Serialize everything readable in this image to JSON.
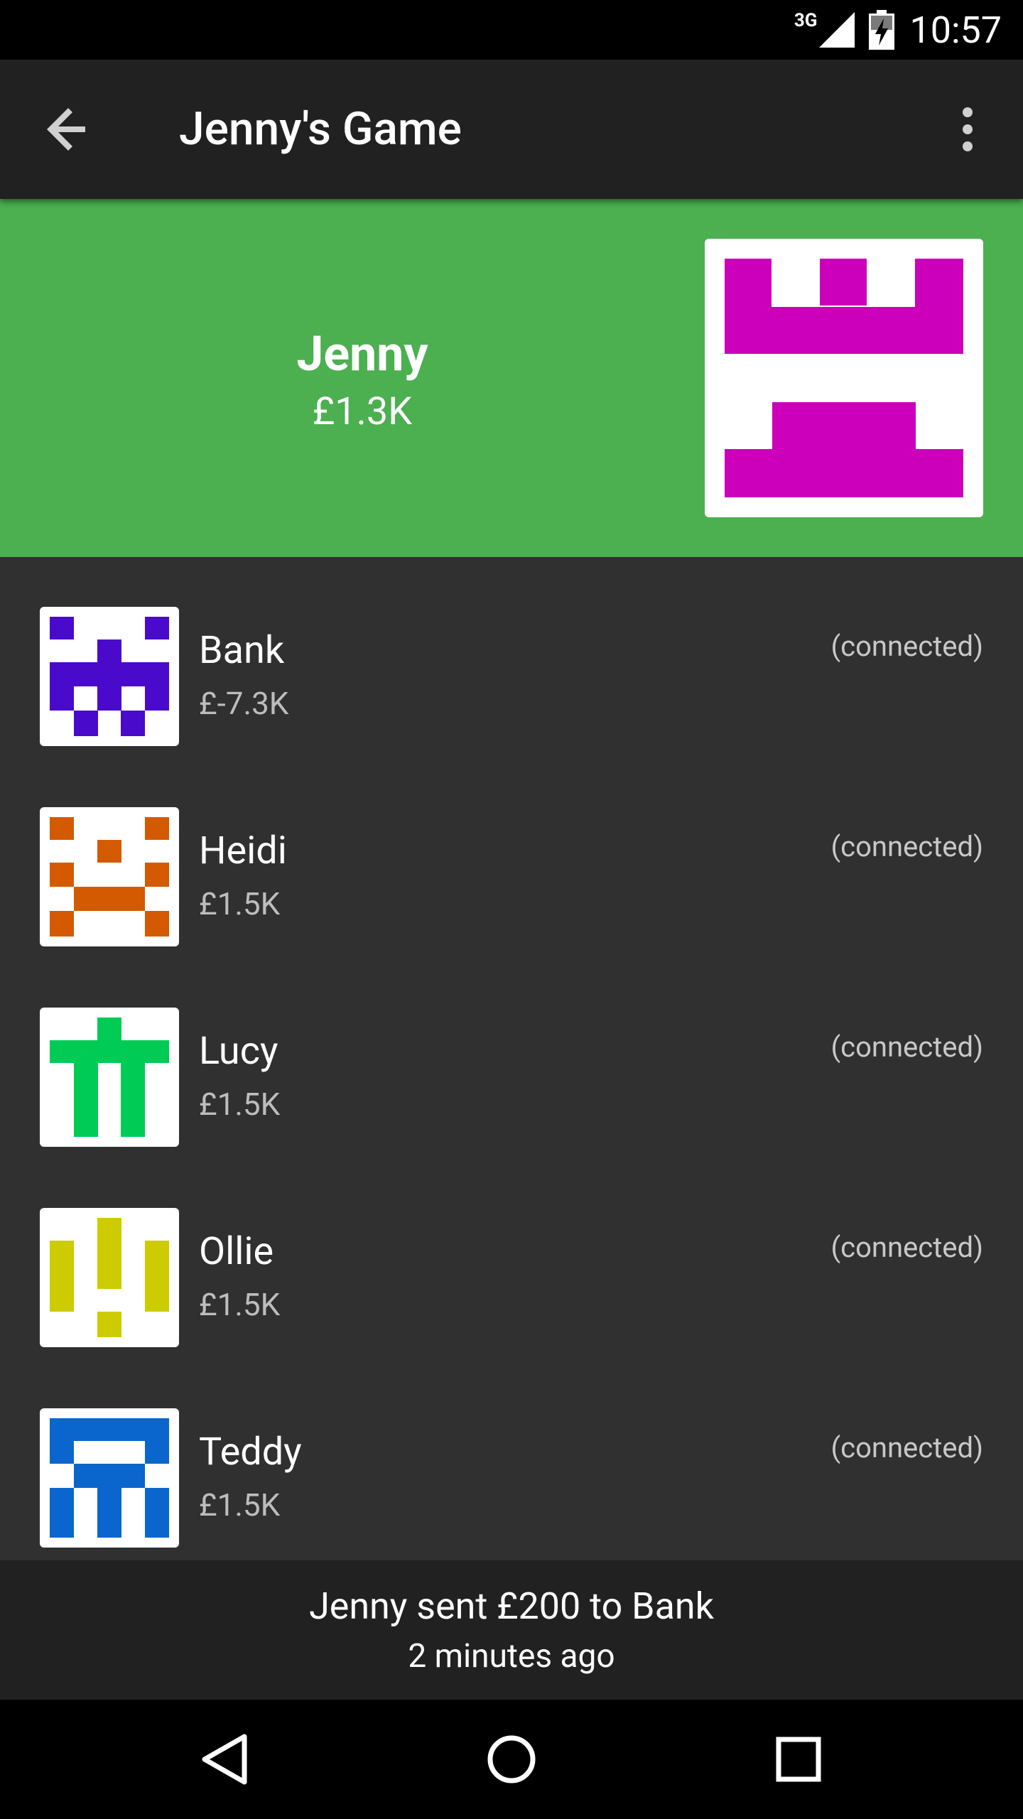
{
  "status_bar": {
    "network": "3G",
    "time": "10:57"
  },
  "app_bar": {
    "title": "Jenny's Game"
  },
  "hero": {
    "name": "Jenny",
    "balance": "£1.3K",
    "avatar_color": "#cc00bb",
    "background_color": "#4caf50"
  },
  "players": [
    {
      "name": "Bank",
      "balance": "£-7.3K",
      "status": "(connected)",
      "avatar_color": "#4a0acc"
    },
    {
      "name": "Heidi",
      "balance": "£1.5K",
      "status": "(connected)",
      "avatar_color": "#d35a00"
    },
    {
      "name": "Lucy",
      "balance": "£1.5K",
      "status": "(connected)",
      "avatar_color": "#00cc55"
    },
    {
      "name": "Ollie",
      "balance": "£1.5K",
      "status": "(connected)",
      "avatar_color": "#cccc00"
    },
    {
      "name": "Teddy",
      "balance": "£1.5K",
      "status": "(connected)",
      "avatar_color": "#0a66cc"
    }
  ],
  "activity": {
    "message": "Jenny sent £200 to Bank",
    "time_ago": "2 minutes ago"
  },
  "icons": {
    "back": "arrow-back-icon",
    "more": "more-vert-icon",
    "nav_back": "triangle-back-icon",
    "nav_home": "circle-home-icon",
    "nav_recents": "square-recents-icon"
  }
}
